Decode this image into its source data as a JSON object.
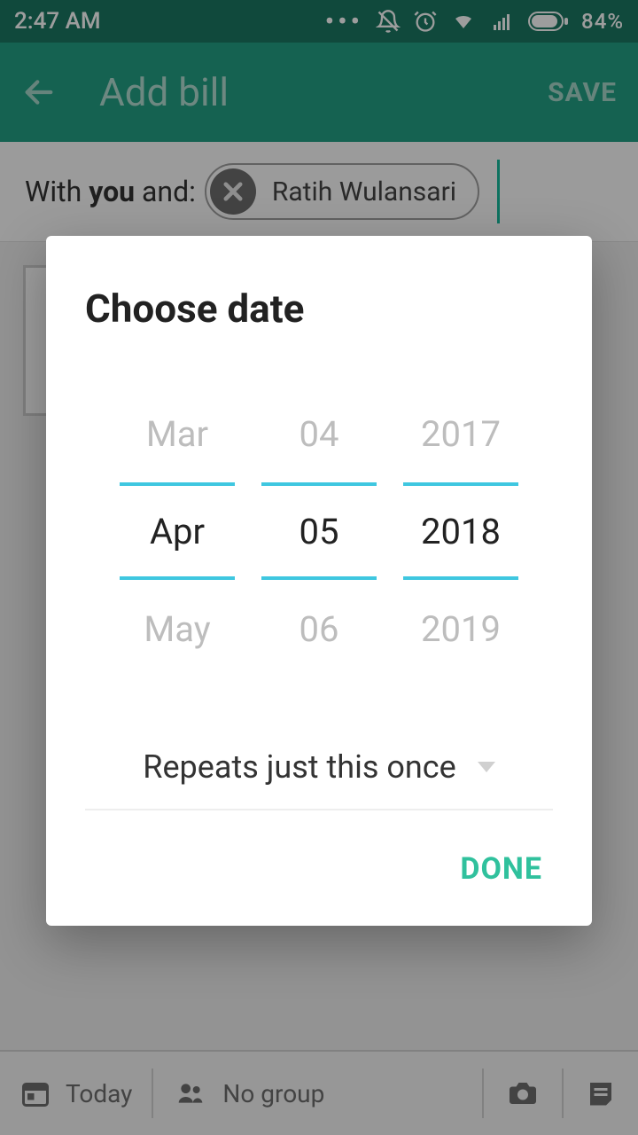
{
  "status": {
    "time": "2:47 AM",
    "battery_percent": "84%"
  },
  "appbar": {
    "title": "Add bill",
    "save_label": "SAVE"
  },
  "with_row": {
    "prefix": "With ",
    "you": "you",
    "suffix": " and:",
    "chip_name": "Ratih Wulansari"
  },
  "bottom": {
    "today": "Today",
    "group": "No group"
  },
  "dialog": {
    "title": "Choose date",
    "month": {
      "prev": "Mar",
      "sel": "Apr",
      "next": "May"
    },
    "day": {
      "prev": "04",
      "sel": "05",
      "next": "06"
    },
    "year": {
      "prev": "2017",
      "sel": "2018",
      "next": "2019"
    },
    "repeat_label": "Repeats just this once",
    "done_label": "DONE"
  }
}
